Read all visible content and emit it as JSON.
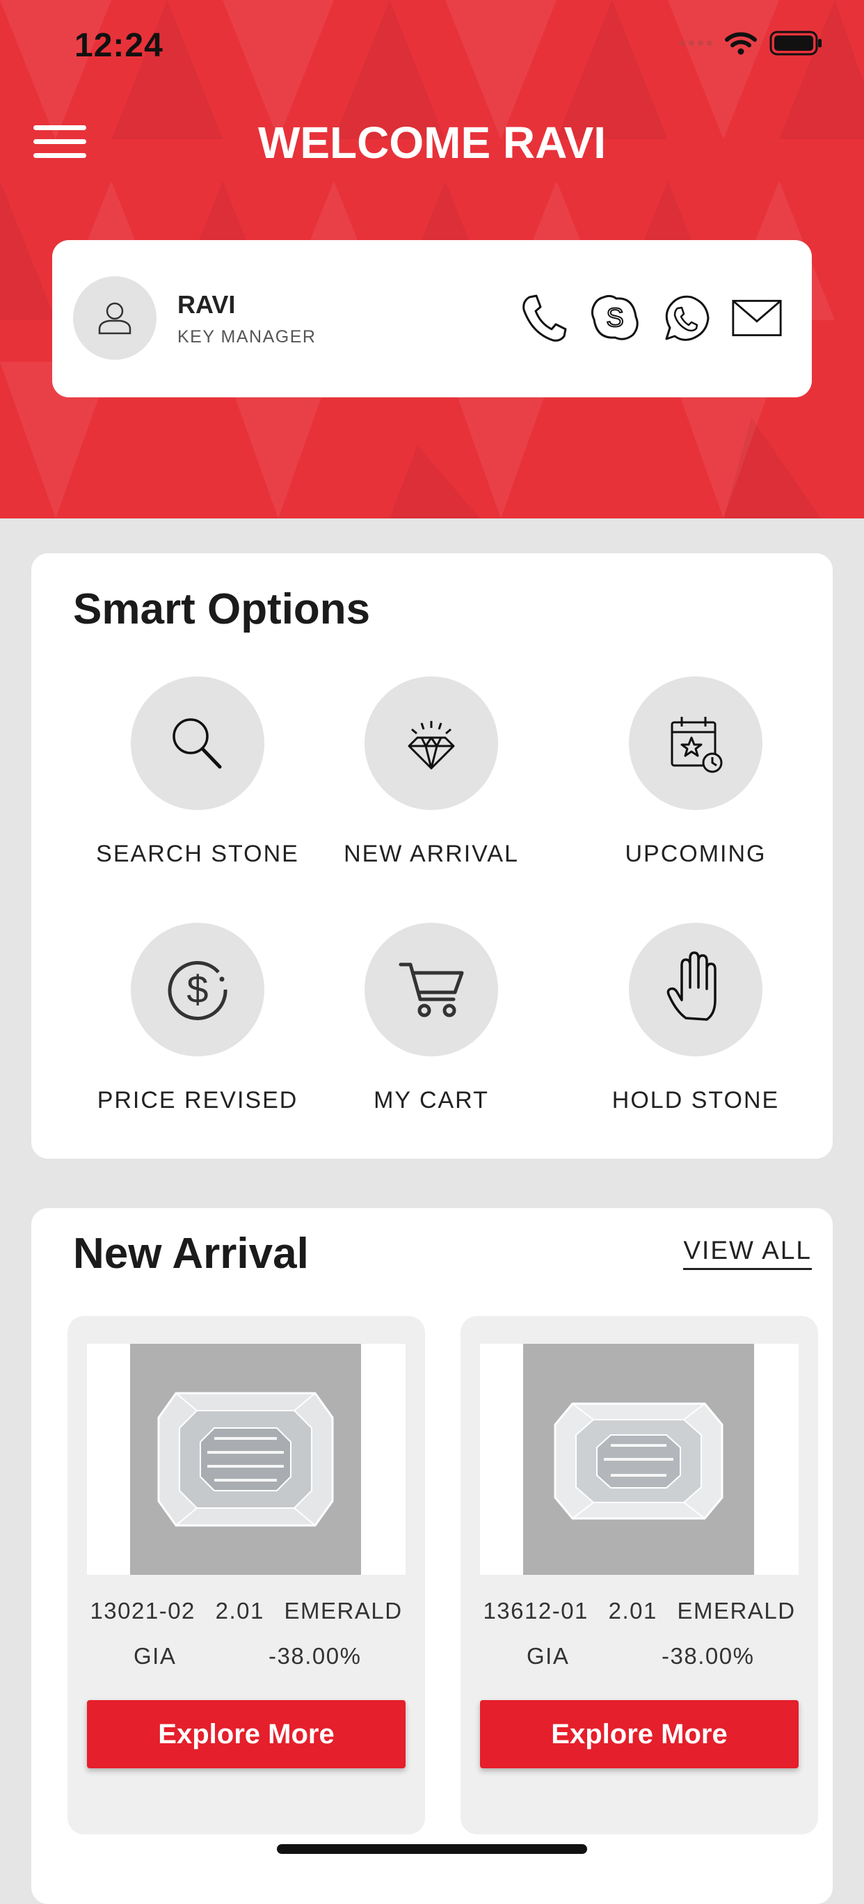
{
  "status_bar": {
    "time": "12:24"
  },
  "header": {
    "title": "WELCOME RAVI",
    "bg_color": "#e8323a",
    "menu_icon": "hamburger-menu-icon"
  },
  "profile": {
    "name": "RAVI",
    "role": "KEY MANAGER",
    "contacts": [
      "phone-icon",
      "skype-icon",
      "whatsapp-icon",
      "mail-icon"
    ]
  },
  "smart_options": {
    "title": "Smart Options",
    "items": [
      {
        "label": "SEARCH STONE",
        "icon": "search-icon"
      },
      {
        "label": "NEW ARRIVAL",
        "icon": "diamond-icon"
      },
      {
        "label": "UPCOMING",
        "icon": "calendar-star-icon"
      },
      {
        "label": "PRICE REVISED",
        "icon": "dollar-icon"
      },
      {
        "label": "MY CART",
        "icon": "cart-icon"
      },
      {
        "label": "HOLD STONE",
        "icon": "hand-icon"
      }
    ]
  },
  "new_arrival": {
    "title": "New Arrival",
    "view_all": "VIEW ALL",
    "products": [
      {
        "id": "13021-02",
        "carat": "2.01",
        "shape": "EMERALD",
        "lab": "GIA",
        "discount": "-38.00%",
        "button": "Explore More"
      },
      {
        "id": "13612-01",
        "carat": "2.01",
        "shape": "EMERALD",
        "lab": "GIA",
        "discount": "-38.00%",
        "button": "Explore More"
      }
    ]
  },
  "colors": {
    "accent": "#e51f2b",
    "background": "#e5e5e5"
  }
}
